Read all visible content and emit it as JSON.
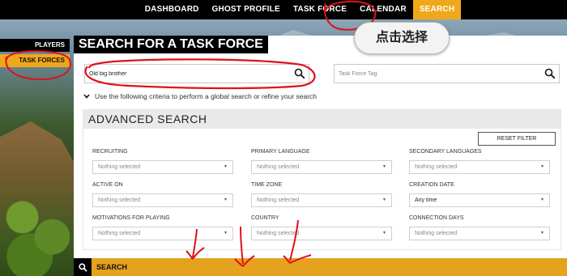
{
  "nav": {
    "items": [
      {
        "label": "DASHBOARD"
      },
      {
        "label": "GHOST PROFILE"
      },
      {
        "label": "TASK FORCE"
      },
      {
        "label": "CALENDAR"
      },
      {
        "label": "SEARCH"
      }
    ],
    "active_index": 4
  },
  "sidebar": {
    "items": [
      {
        "label": "PLAYERS"
      },
      {
        "label": "TASK FORCES"
      }
    ]
  },
  "page": {
    "title": "SEARCH FOR A TASK FORCE"
  },
  "search": {
    "name_value": "Old big brother",
    "tag_placeholder": "Task Force Tag",
    "criteria_text": "Use the following criteria to perform a global search or refine your search"
  },
  "advanced": {
    "title": "ADVANCED SEARCH",
    "reset_label": "RESET FILTER",
    "fields": {
      "recruiting": {
        "label": "RECRUITING",
        "value": "Nothing selected"
      },
      "primary_language": {
        "label": "PRIMARY LANGUAGE",
        "value": "Nothing selected"
      },
      "secondary_languages": {
        "label": "SECONDARY LANGUAGES",
        "value": "Nothing selected"
      },
      "active_on": {
        "label": "ACTIVE ON",
        "value": "Nothing selected"
      },
      "time_zone": {
        "label": "TIME ZONE",
        "value": "Nothing selected"
      },
      "creation_date": {
        "label": "CREATION DATE",
        "value": "Any time"
      },
      "motivations": {
        "label": "MOTIVATIONS FOR PLAYING",
        "value": "Nothing selected"
      },
      "country": {
        "label": "COUNTRY",
        "value": "Nothing selected"
      },
      "connection_days": {
        "label": "CONNECTION DAYS",
        "value": "Nothing selected"
      }
    }
  },
  "bottom": {
    "search_label": "SEARCH"
  },
  "annotation": {
    "callout_text": "点击选择"
  },
  "colors": {
    "accent": "#f0a81b",
    "bottom_bar": "#e4a21e",
    "annotation_red": "#e0101a"
  }
}
